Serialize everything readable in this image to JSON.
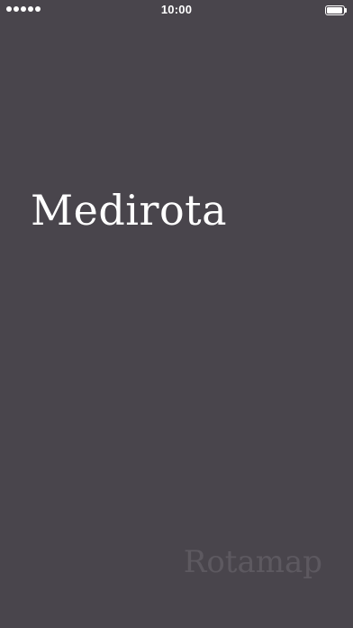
{
  "status_bar": {
    "signal_icon": "cellular-dots-icon",
    "time": "10:00",
    "battery_icon": "battery-full-icon"
  },
  "splash": {
    "app_name": "Medirota",
    "brand": "Rotamap"
  },
  "colors": {
    "background": "#49454c",
    "title": "#ffffff",
    "brand": "#5d5960"
  }
}
